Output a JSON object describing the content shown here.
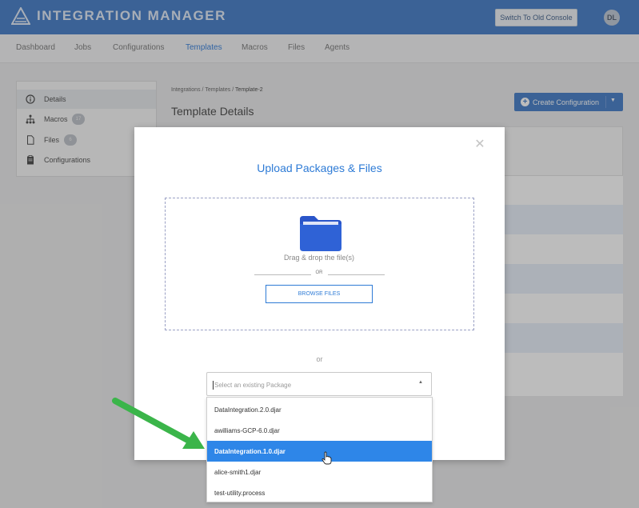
{
  "app": {
    "title": "INTEGRATION MANAGER",
    "old_console_label": "Switch To Old Console",
    "avatar_initials": "DL"
  },
  "nav": {
    "items": [
      "Dashboard",
      "Jobs",
      "Configurations",
      "Templates",
      "Macros",
      "Files",
      "Agents"
    ],
    "active": "Templates"
  },
  "sidebar": {
    "items": [
      {
        "label": "Details",
        "icon": "info-circle-icon"
      },
      {
        "label": "Macros",
        "icon": "hierarchy-icon",
        "badge": "17"
      },
      {
        "label": "Files",
        "icon": "file-icon",
        "badge": "6"
      },
      {
        "label": "Configurations",
        "icon": "clipboard-icon"
      }
    ]
  },
  "breadcrumb": {
    "parts": [
      "Integrations",
      "Templates"
    ],
    "current": "Template-2",
    "separator": "/"
  },
  "page": {
    "title": "Template Details",
    "create_label": "Create Configuration"
  },
  "modal": {
    "title": "Upload Packages & Files",
    "drag_text": "Drag & drop the file(s)",
    "or_small": "OR",
    "browse_label": "BROWSE FILES",
    "or_text": "or",
    "select_placeholder": "Select an existing Package",
    "options": [
      "DataIntegration.2.0.djar",
      "awilliams-GCP-6.0.djar",
      "DataIntegration.1.0.djar",
      "alice-smith1.djar",
      "test-utility.process"
    ],
    "selected_option": "DataIntegration.1.0.djar"
  },
  "colors": {
    "header": "#2f6fc2",
    "accent": "#2e7bd6",
    "selected": "#2e86e8",
    "arrow": "#3bb54a"
  }
}
